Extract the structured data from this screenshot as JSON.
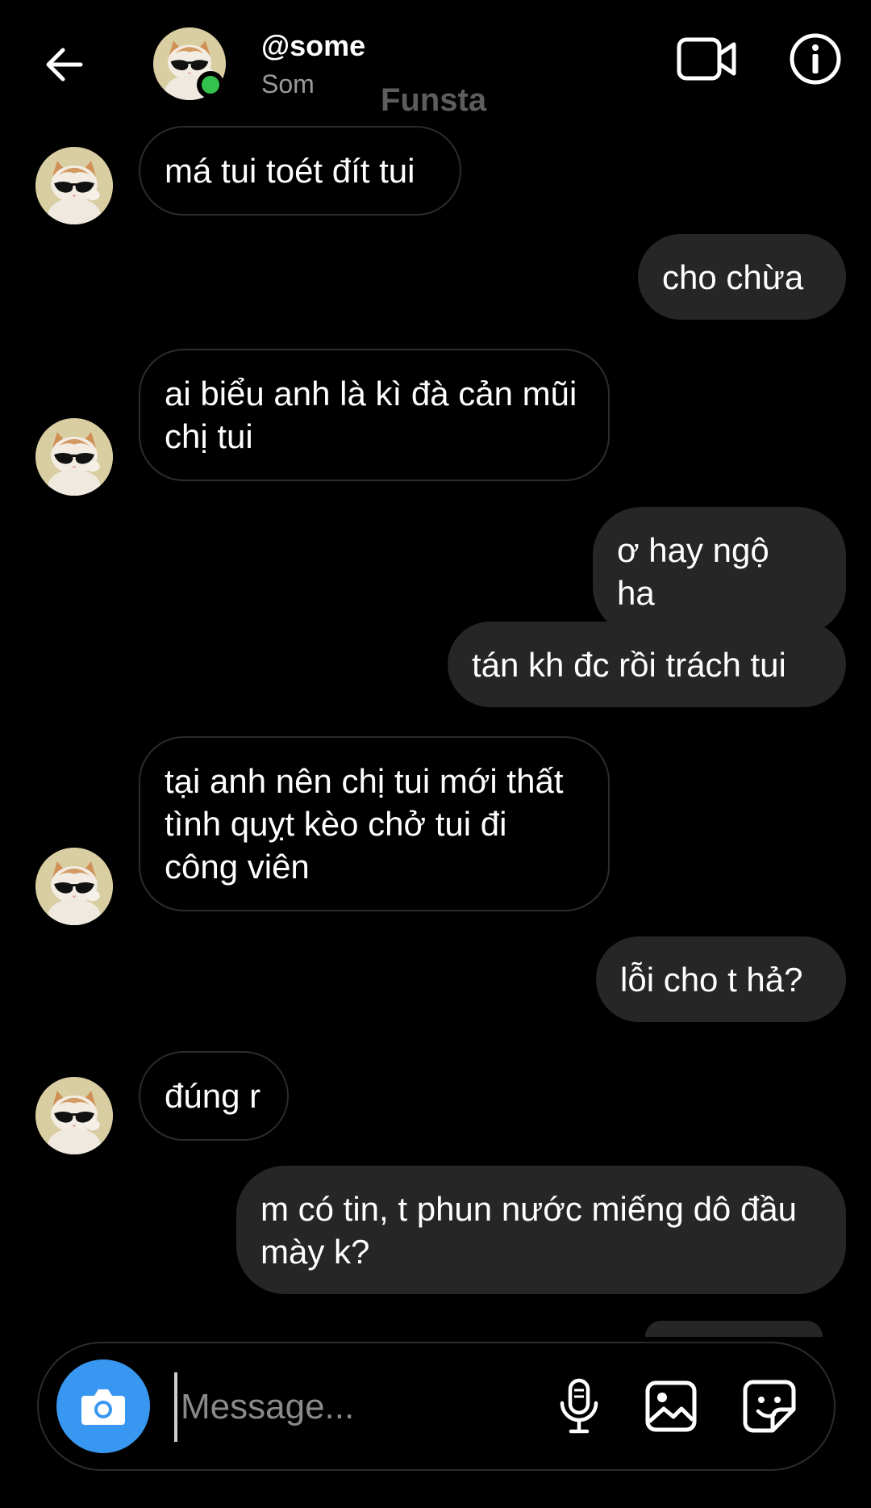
{
  "header": {
    "username": "@some",
    "subtitle": "Som",
    "watermark": "Funsta",
    "online_color": "#33c24e"
  },
  "icons": {
    "back": "arrow-left-icon",
    "video": "video-camera-icon",
    "info": "info-icon",
    "camera": "camera-icon",
    "mic": "microphone-icon",
    "gallery": "image-icon",
    "sticker": "sticker-icon"
  },
  "messages": [
    {
      "sender": "them",
      "text": "má tui toét đít tui"
    },
    {
      "sender": "me",
      "text": "cho chừa"
    },
    {
      "sender": "them",
      "text": "ai biểu anh là kì đà cản mũi chị tui"
    },
    {
      "sender": "me",
      "text": "ơ hay ngộ ha"
    },
    {
      "sender": "me",
      "text": "tán kh đc rồi trách tui"
    },
    {
      "sender": "them",
      "text": "tại anh nên chị tui mới thất tình quỵt kèo chở tui đi công viên"
    },
    {
      "sender": "me",
      "text": "lỗi cho t hả?"
    },
    {
      "sender": "them",
      "text": "đúng r"
    },
    {
      "sender": "me",
      "text": "m có tin, t phun nước miếng dô đầu mày k?"
    }
  ],
  "composer": {
    "placeholder": "Message...",
    "value": "",
    "accent": "#3897f0"
  },
  "colors": {
    "background": "#000000",
    "outgoing_bubble": "#262626",
    "incoming_border": "#2c2c2c"
  }
}
